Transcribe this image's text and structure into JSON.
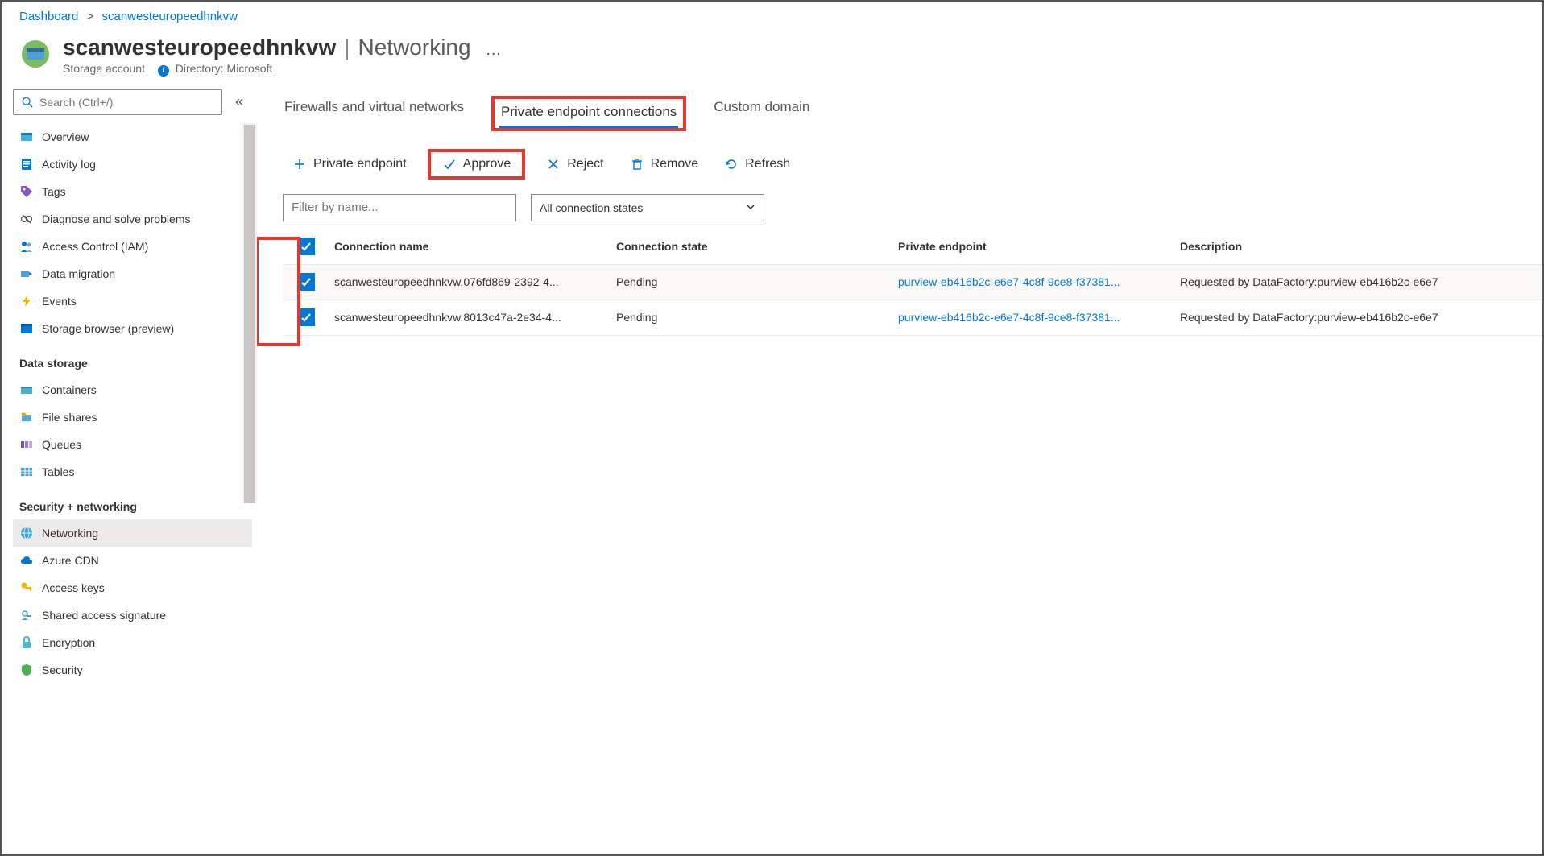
{
  "breadcrumb": {
    "root": "Dashboard",
    "current": "scanwesteuropeedhnkvw"
  },
  "header": {
    "resource_name": "scanwesteuropeedhnkvw",
    "blade_name": "Networking",
    "resource_type": "Storage account",
    "directory_label": "Directory:",
    "directory_value": "Microsoft"
  },
  "search": {
    "placeholder": "Search (Ctrl+/)"
  },
  "sidebar": {
    "group1": [
      {
        "label": "Overview"
      },
      {
        "label": "Activity log"
      },
      {
        "label": "Tags"
      },
      {
        "label": "Diagnose and solve problems"
      },
      {
        "label": "Access Control (IAM)"
      },
      {
        "label": "Data migration"
      },
      {
        "label": "Events"
      },
      {
        "label": "Storage browser (preview)"
      }
    ],
    "group2_title": "Data storage",
    "group2": [
      {
        "label": "Containers"
      },
      {
        "label": "File shares"
      },
      {
        "label": "Queues"
      },
      {
        "label": "Tables"
      }
    ],
    "group3_title": "Security + networking",
    "group3": [
      {
        "label": "Networking"
      },
      {
        "label": "Azure CDN"
      },
      {
        "label": "Access keys"
      },
      {
        "label": "Shared access signature"
      },
      {
        "label": "Encryption"
      },
      {
        "label": "Security"
      }
    ]
  },
  "tabs": {
    "t0": "Firewalls and virtual networks",
    "t1": "Private endpoint connections",
    "t2": "Custom domain"
  },
  "toolbar": {
    "add": "Private endpoint",
    "approve": "Approve",
    "reject": "Reject",
    "remove": "Remove",
    "refresh": "Refresh"
  },
  "filters": {
    "name_placeholder": "Filter by name...",
    "state_dd": "All connection states"
  },
  "table": {
    "headers": {
      "conn": "Connection name",
      "state": "Connection state",
      "pe": "Private endpoint",
      "desc": "Description"
    },
    "rows": [
      {
        "conn": "scanwesteuropeedhnkvw.076fd869-2392-4...",
        "state": "Pending",
        "pe": "purview-eb416b2c-e6e7-4c8f-9ce8-f37381...",
        "desc": "Requested by DataFactory:purview-eb416b2c-e6e7"
      },
      {
        "conn": "scanwesteuropeedhnkvw.8013c47a-2e34-4...",
        "state": "Pending",
        "pe": "purview-eb416b2c-e6e7-4c8f-9ce8-f37381...",
        "desc": "Requested by DataFactory:purview-eb416b2c-e6e7"
      }
    ]
  }
}
